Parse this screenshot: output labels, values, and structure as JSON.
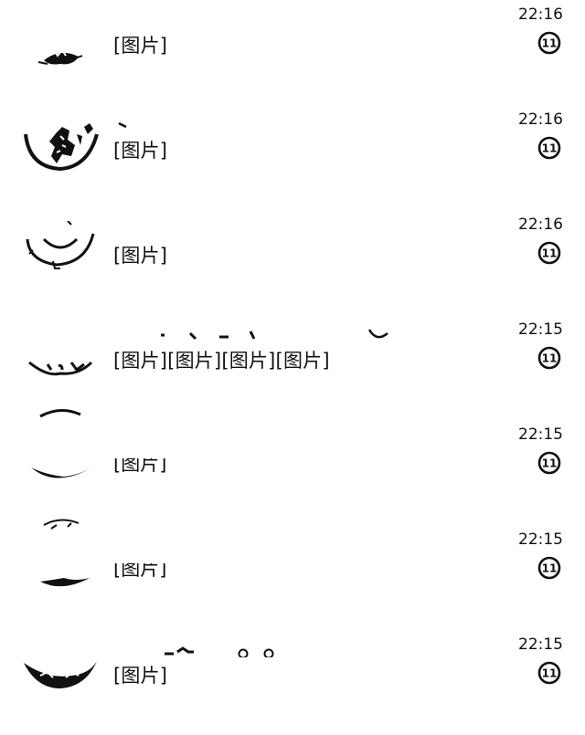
{
  "chats": [
    {
      "preview": "[图片]",
      "time": "22:16",
      "badge": "11",
      "avatar_icon": "group-avatar-icon"
    },
    {
      "preview": "[图片]",
      "time": "22:16",
      "badge": "11",
      "avatar_icon": "group-avatar-icon"
    },
    {
      "preview": "[图片]",
      "time": "22:16",
      "badge": "11",
      "avatar_icon": "group-avatar-icon"
    },
    {
      "preview": "[图片][图片][图片][图片]",
      "time": "22:15",
      "badge": "11",
      "avatar_icon": "group-avatar-icon"
    },
    {
      "preview": "[图片]",
      "time": "22:15",
      "badge": "11",
      "avatar_icon": "group-avatar-icon"
    },
    {
      "preview": "[图片]",
      "time": "22:15",
      "badge": "11",
      "avatar_icon": "group-avatar-icon"
    },
    {
      "preview": "[图片]",
      "time": "22:15",
      "badge": "11",
      "avatar_icon": "group-avatar-icon"
    }
  ],
  "colors": {
    "text": "#111111",
    "background": "#ffffff"
  }
}
